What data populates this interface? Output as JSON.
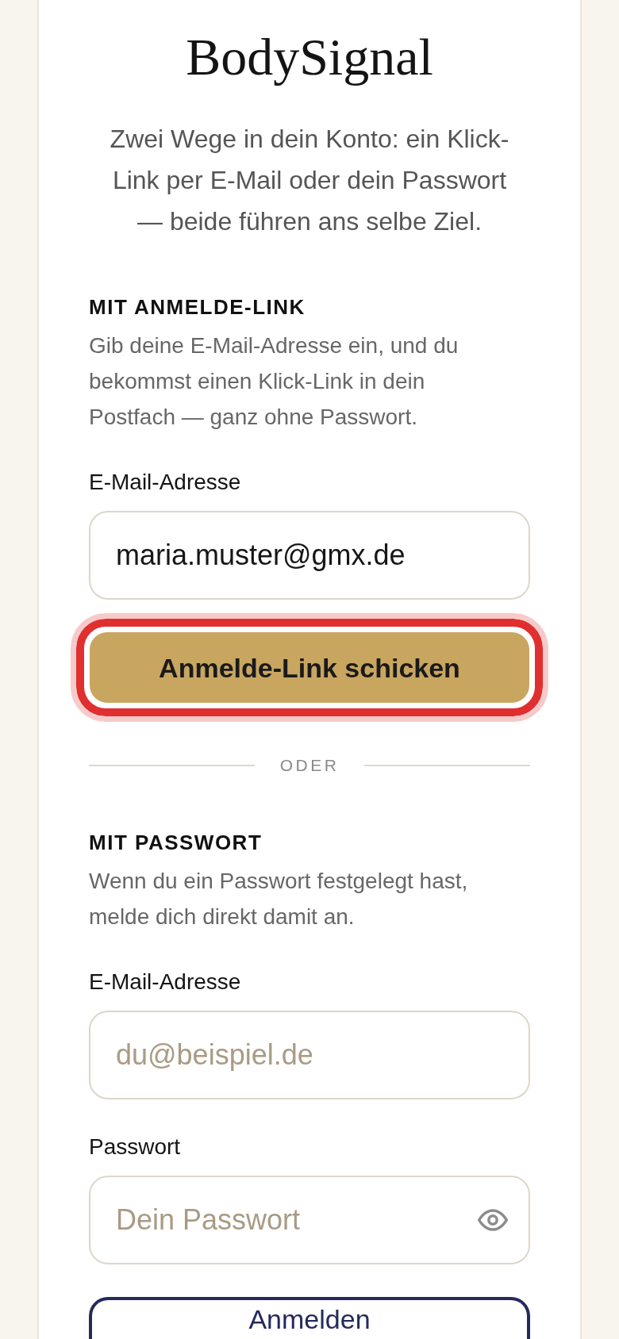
{
  "card": {
    "title": "BodySignal",
    "subtitle": "Zwei Wege in dein Konto: ein Klick-Link per E-Mail oder dein Passwort — beide führen ans selbe Ziel."
  },
  "link_section": {
    "heading": "MIT ANMELDE-LINK",
    "hint": "Gib deine E-Mail-Adresse ein, und du bekommst einen Klick-Link in dein Postfach — ganz ohne Passwort.",
    "fields": [
      {
        "label": "E-Mail-Adresse",
        "value": "maria.muster@gmx.de"
      }
    ],
    "button": {
      "label": "Anmelde-Link schicken",
      "kind": "primary",
      "highlighted": true
    }
  },
  "divider": {
    "label": "ODER"
  },
  "password_section": {
    "heading": "MIT PASSWORT",
    "hint": "Wenn du ein Passwort festgelegt hast, melde dich direkt damit an.",
    "fields": [
      {
        "label": "E-Mail-Adresse",
        "placeholder": "du@beispiel.de"
      },
      {
        "label": "Passwort",
        "placeholder": "Dein Passwort",
        "reveal_toggle": true
      }
    ],
    "button": {
      "label": "Anmelden",
      "kind": "outline",
      "highlighted": false
    }
  }
}
